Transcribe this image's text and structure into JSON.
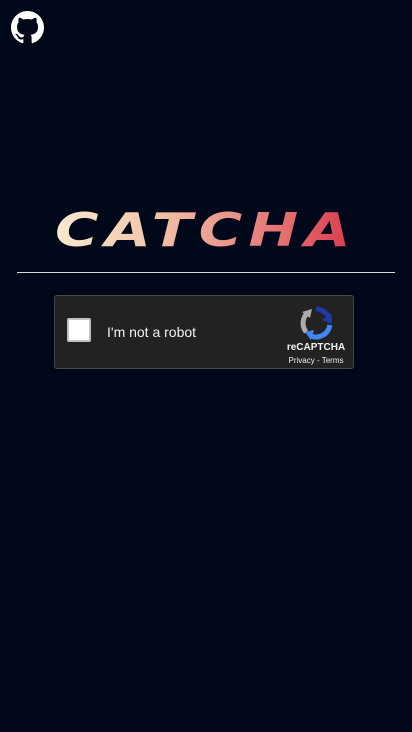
{
  "header": {
    "github_icon": "github-icon"
  },
  "logo": {
    "text": "CATCHA",
    "gradient_colors": [
      "#f8e9cf",
      "#f3c9ac",
      "#e88781",
      "#d9384a"
    ]
  },
  "recaptcha": {
    "checkbox_label": "I'm not a robot",
    "brand": "reCAPTCHA",
    "privacy_link": "Privacy",
    "separator": "-",
    "terms_link": "Terms",
    "icon": "recaptcha-icon"
  },
  "colors": {
    "background": "#01081a",
    "divider": "#d9d9d9",
    "widget_background": "#222222"
  }
}
